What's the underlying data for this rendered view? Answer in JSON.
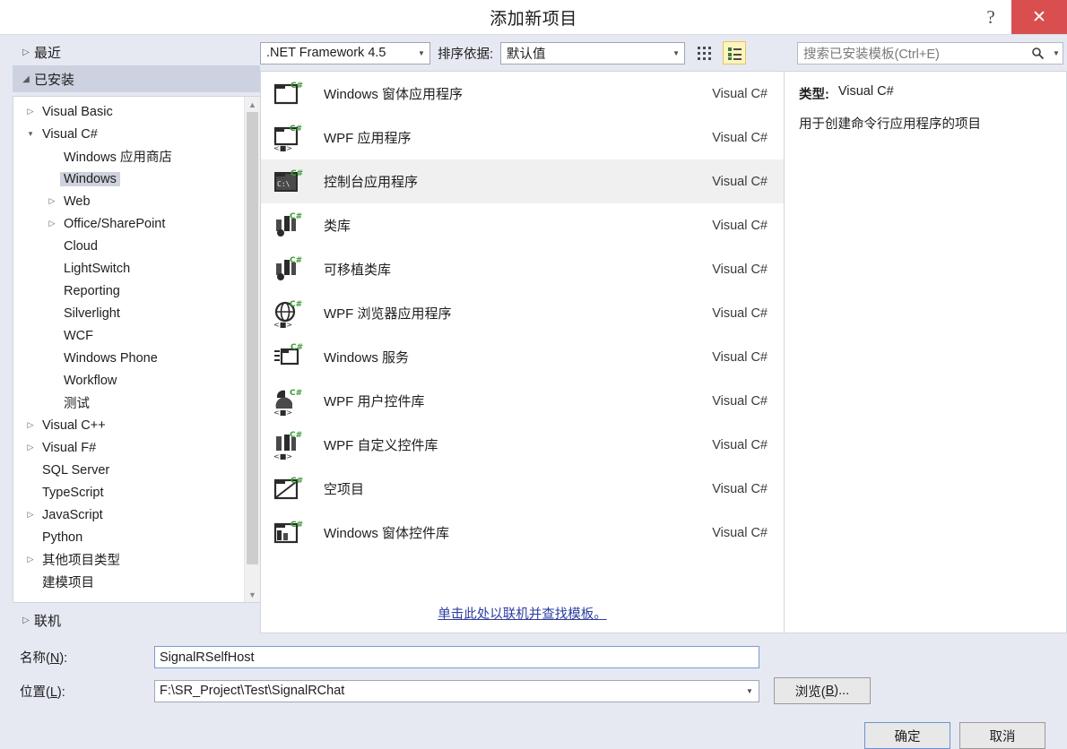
{
  "window": {
    "title": "添加新项目",
    "help_label": "?",
    "close_label": "✕"
  },
  "sidebar": {
    "groups": [
      {
        "label": "最近",
        "state": "collapsed"
      },
      {
        "label": "已安装",
        "state": "expanded"
      },
      {
        "label": "联机",
        "state": "collapsed"
      }
    ],
    "tree": [
      {
        "label": "Visual Basic",
        "level": 0,
        "arrow": "right",
        "selected": false
      },
      {
        "label": "Visual C#",
        "level": 0,
        "arrow": "down",
        "selected": false
      },
      {
        "label": "Windows 应用商店",
        "level": 1,
        "arrow": "none",
        "selected": false
      },
      {
        "label": "Windows",
        "level": 1,
        "arrow": "none",
        "selected": true
      },
      {
        "label": "Web",
        "level": 1,
        "arrow": "right",
        "selected": false
      },
      {
        "label": "Office/SharePoint",
        "level": 1,
        "arrow": "right",
        "selected": false
      },
      {
        "label": "Cloud",
        "level": 1,
        "arrow": "none",
        "selected": false
      },
      {
        "label": "LightSwitch",
        "level": 1,
        "arrow": "none",
        "selected": false
      },
      {
        "label": "Reporting",
        "level": 1,
        "arrow": "none",
        "selected": false
      },
      {
        "label": "Silverlight",
        "level": 1,
        "arrow": "none",
        "selected": false
      },
      {
        "label": "WCF",
        "level": 1,
        "arrow": "none",
        "selected": false
      },
      {
        "label": "Windows Phone",
        "level": 1,
        "arrow": "none",
        "selected": false
      },
      {
        "label": "Workflow",
        "level": 1,
        "arrow": "none",
        "selected": false
      },
      {
        "label": "测试",
        "level": 1,
        "arrow": "none",
        "selected": false
      },
      {
        "label": "Visual C++",
        "level": 0,
        "arrow": "right",
        "selected": false
      },
      {
        "label": "Visual F#",
        "level": 0,
        "arrow": "right",
        "selected": false
      },
      {
        "label": "SQL Server",
        "level": 0,
        "arrow": "none",
        "selected": false
      },
      {
        "label": "TypeScript",
        "level": 0,
        "arrow": "none",
        "selected": false
      },
      {
        "label": "JavaScript",
        "level": 0,
        "arrow": "right",
        "selected": false
      },
      {
        "label": "Python",
        "level": 0,
        "arrow": "none",
        "selected": false
      },
      {
        "label": "其他项目类型",
        "level": 0,
        "arrow": "right",
        "selected": false
      },
      {
        "label": "建模项目",
        "level": 0,
        "arrow": "none",
        "selected": false
      }
    ]
  },
  "toolbar": {
    "framework_value": ".NET Framework 4.5",
    "sort_label": "排序依据:",
    "sort_value": "默认值",
    "grid_view_icon": "grid-view-icon",
    "list_view_icon": "list-view-icon"
  },
  "search": {
    "placeholder": "搜索已安装模板(Ctrl+E)",
    "search_icon": "search-icon",
    "dropdown_icon": "chevron-down-icon"
  },
  "templates": {
    "language_column": "Visual C#",
    "items": [
      {
        "name": "Windows 窗体应用程序",
        "language": "Visual C#",
        "icon": "winforms-app-icon",
        "selected": false
      },
      {
        "name": "WPF 应用程序",
        "language": "Visual C#",
        "icon": "wpf-app-icon",
        "selected": false
      },
      {
        "name": "控制台应用程序",
        "language": "Visual C#",
        "icon": "console-app-icon",
        "selected": true
      },
      {
        "name": "类库",
        "language": "Visual C#",
        "icon": "class-library-icon",
        "selected": false
      },
      {
        "name": "可移植类库",
        "language": "Visual C#",
        "icon": "portable-class-library-icon",
        "selected": false
      },
      {
        "name": "WPF 浏览器应用程序",
        "language": "Visual C#",
        "icon": "wpf-browser-app-icon",
        "selected": false
      },
      {
        "name": "Windows 服务",
        "language": "Visual C#",
        "icon": "windows-service-icon",
        "selected": false
      },
      {
        "name": "WPF 用户控件库",
        "language": "Visual C#",
        "icon": "wpf-user-control-icon",
        "selected": false
      },
      {
        "name": "WPF 自定义控件库",
        "language": "Visual C#",
        "icon": "wpf-custom-control-icon",
        "selected": false
      },
      {
        "name": "空项目",
        "language": "Visual C#",
        "icon": "empty-project-icon",
        "selected": false
      },
      {
        "name": "Windows 窗体控件库",
        "language": "Visual C#",
        "icon": "winforms-control-library-icon",
        "selected": false
      }
    ],
    "online_link": "单击此处以联机并查找模板。"
  },
  "info": {
    "type_label": "类型:",
    "type_value": "Visual C#",
    "description": "用于创建命令行应用程序的项目"
  },
  "form": {
    "name_label_pre": "名称(",
    "name_label_key": "N",
    "name_label_post": "):",
    "name_value": "SignalRSelfHost",
    "location_label_pre": "位置(",
    "location_label_key": "L",
    "location_label_post": "):",
    "location_value": "F:\\SR_Project\\Test\\SignalRChat",
    "browse_label_pre": "浏览(",
    "browse_label_key": "B",
    "browse_label_post": ")..."
  },
  "actions": {
    "ok_label": "确定",
    "cancel_label": "取消"
  },
  "colors": {
    "dialog_background": "#e6e9f2",
    "close_button": "#d94f4f",
    "selected_row": "#f0f0f0",
    "tree_selection": "#cdd2dd",
    "link": "#2b3c9e",
    "active_toggle": "#fdf4bf",
    "csharp_green": "#3a9b35"
  }
}
